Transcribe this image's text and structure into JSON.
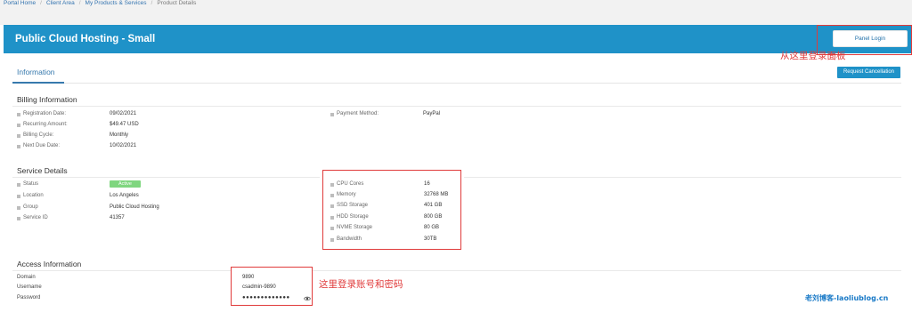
{
  "breadcrumb": [
    "Portal Home",
    "Client Area",
    "My Products & Services",
    "Product Details"
  ],
  "header": {
    "title": "Public Cloud Hosting - Small",
    "panel_login": "Panel Login"
  },
  "annotations": {
    "panel": "从这里登录面板",
    "account": "这里登录账号和密码"
  },
  "tabs": {
    "information": "Information",
    "request_cancellation": "Request Cancellation"
  },
  "billing": {
    "title": "Billing Information",
    "rows": [
      {
        "label": "Registration Date:",
        "value": "09/02/2021"
      },
      {
        "label": "Recurring Amount:",
        "value": "$49.47 USD"
      },
      {
        "label": "Billing Cycle:",
        "value": "Monthly"
      },
      {
        "label": "Next Due Date:",
        "value": "10/02/2021"
      }
    ],
    "payment": {
      "label": "Payment Method:",
      "value": "PayPal"
    }
  },
  "service": {
    "title": "Service Details",
    "rows": [
      {
        "label": "Status",
        "value": "Active"
      },
      {
        "label": "Location",
        "value": "Los Angeles"
      },
      {
        "label": "Group",
        "value": "Public Cloud Hosting"
      },
      {
        "label": "Service ID",
        "value": "41357"
      }
    ],
    "specs": [
      {
        "label": "CPU Cores",
        "value": "16"
      },
      {
        "label": "Memory",
        "value": "32768 MB"
      },
      {
        "label": "SSD Storage",
        "value": "401 GB"
      },
      {
        "label": "HDD Storage",
        "value": "800 GB"
      },
      {
        "label": "NVME Storage",
        "value": "80 GB"
      },
      {
        "label": "Bandwidth",
        "value": "30TB"
      }
    ]
  },
  "access": {
    "title": "Access Information",
    "rows": [
      {
        "label": "Domain",
        "value": "9890"
      },
      {
        "label": "Username",
        "value": "csadmin-9890"
      },
      {
        "label": "Password",
        "value": "●●●●●●●●●●●●●"
      }
    ]
  },
  "watermark": "老刘博客-laoliublog.cn",
  "colors": {
    "header": "#1f92c8",
    "annotation": "#e03b3b",
    "active": "#7fd67f"
  }
}
